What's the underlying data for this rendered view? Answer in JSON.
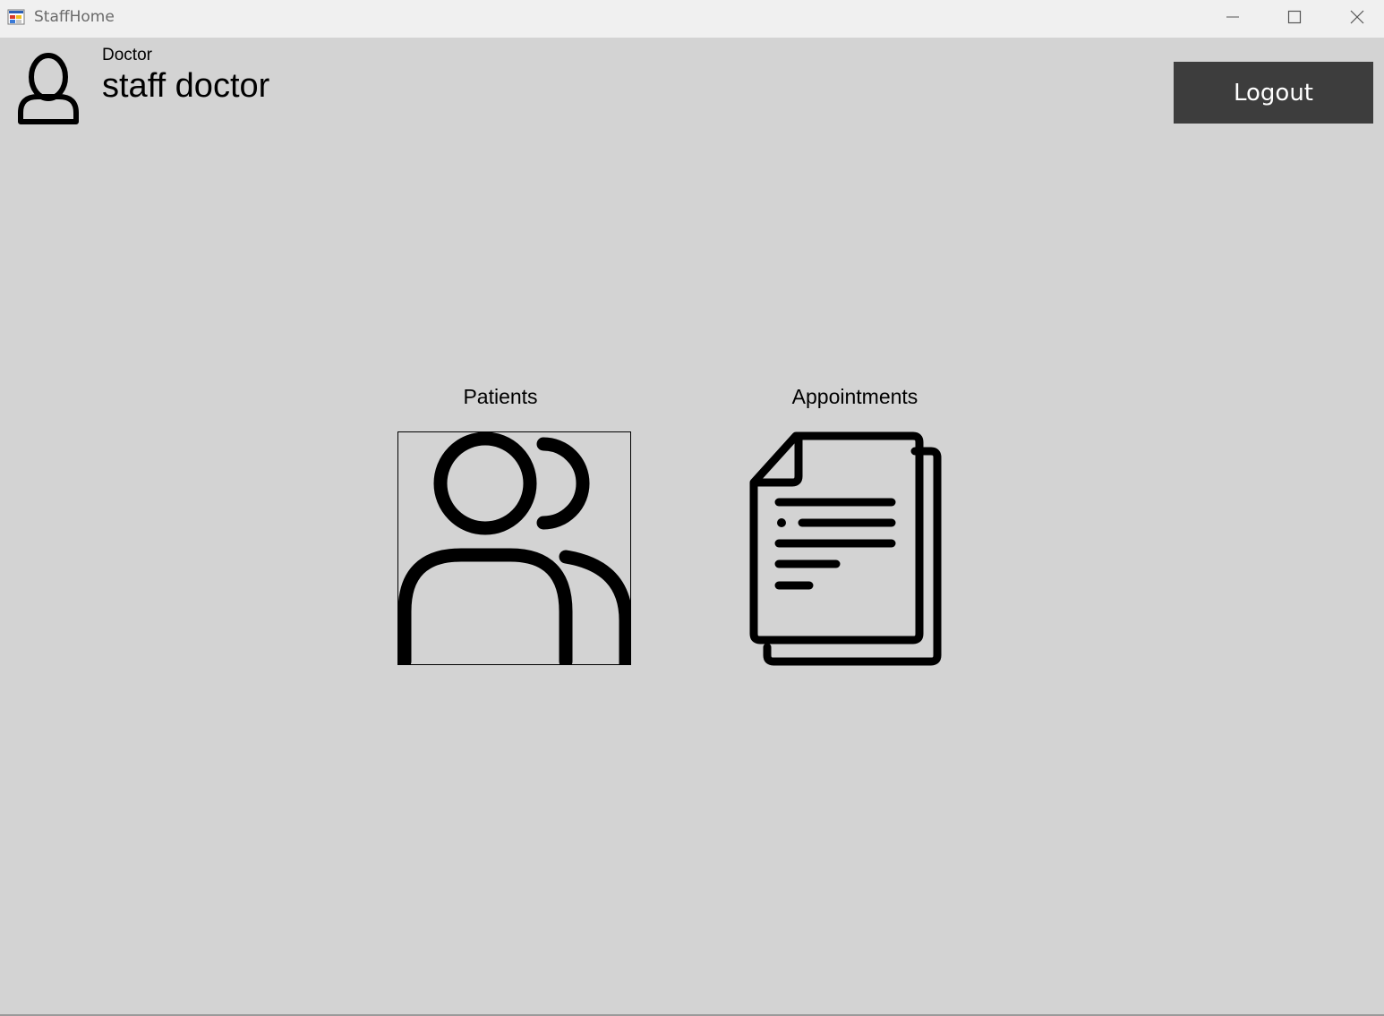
{
  "window": {
    "title": "StaffHome",
    "icon": "app-window-icon",
    "controls": {
      "minimize_icon": "minimize-icon",
      "maximize_icon": "maximize-icon",
      "close_icon": "close-icon"
    }
  },
  "header": {
    "avatar_icon": "user-icon",
    "role": "Doctor",
    "name": "staff doctor",
    "logout_label": "Logout"
  },
  "tiles": {
    "patients": {
      "label": "Patients",
      "icon": "patients-icon"
    },
    "appointments": {
      "label": "Appointments",
      "icon": "documents-icon"
    }
  },
  "colors": {
    "background": "#d3d3d3",
    "titlebar": "#f0f0f0",
    "logout_button": "#3d3d3d",
    "logout_text": "#ffffff",
    "icon_stroke": "#000000"
  }
}
